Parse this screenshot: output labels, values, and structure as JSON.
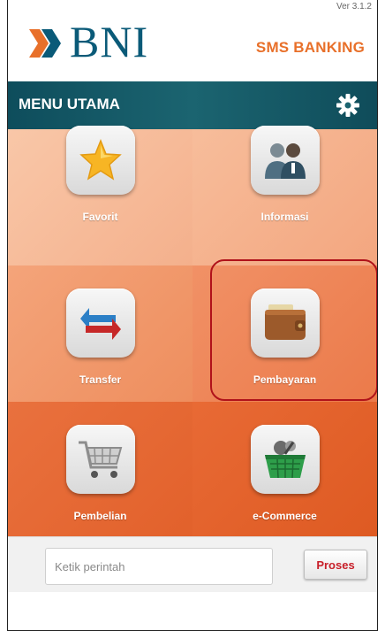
{
  "header": {
    "version": "Ver 3.1.2",
    "brand": "BNI",
    "title": "SMS BANKING"
  },
  "menubar": {
    "title": "MENU UTAMA"
  },
  "menu": [
    {
      "label": "Favorit",
      "icon": "star-icon"
    },
    {
      "label": "Informasi",
      "icon": "people-icon"
    },
    {
      "label": "Transfer",
      "icon": "transfer-arrows-icon"
    },
    {
      "label": "Pembayaran",
      "icon": "wallet-icon"
    },
    {
      "label": "Pembelian",
      "icon": "shopping-cart-icon"
    },
    {
      "label": "e-Commerce",
      "icon": "shopping-basket-icon"
    }
  ],
  "command": {
    "placeholder": "Ketik perintah",
    "value": "",
    "submit_label": "Proses"
  },
  "colors": {
    "brand_blue": "#0a5a78",
    "brand_orange": "#e8702a",
    "menubar": "#0e4d5c",
    "highlight": "#b0121a"
  }
}
